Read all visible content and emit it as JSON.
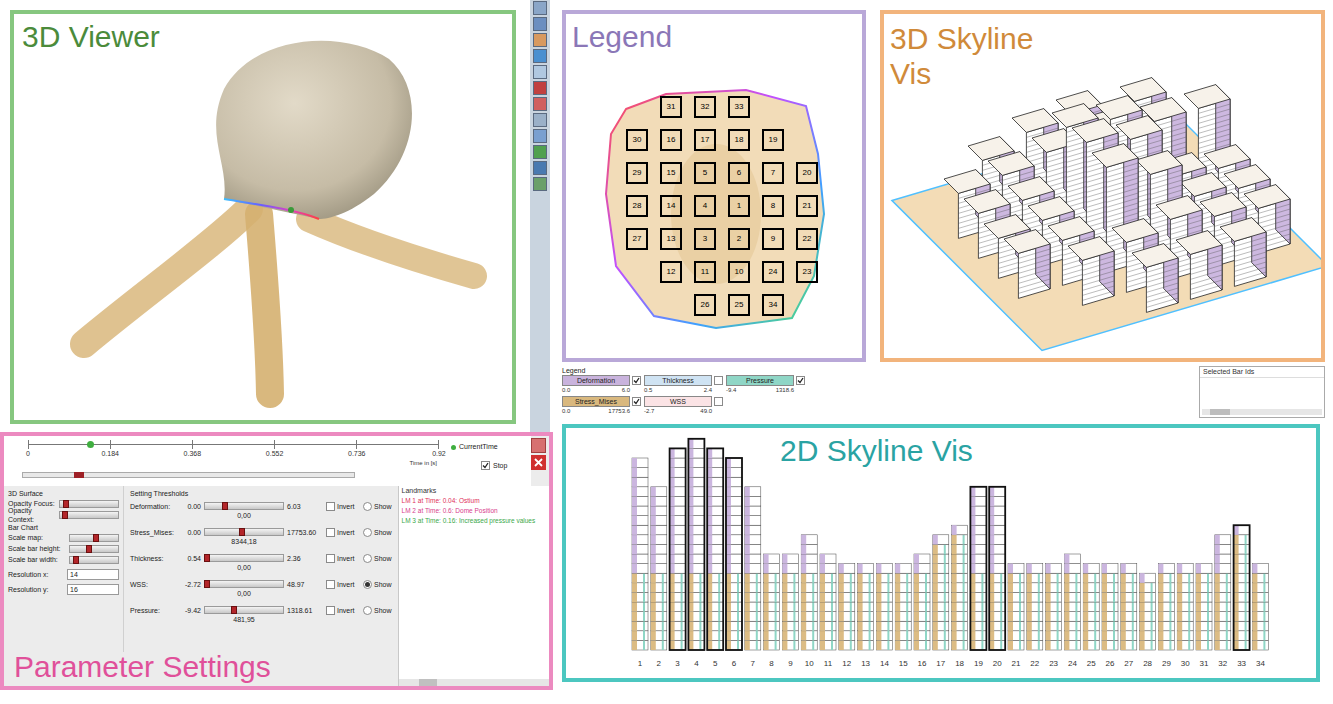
{
  "viewer3d": {
    "title": "3D Viewer"
  },
  "legendPanel": {
    "title": "Legend",
    "grid": [
      [
        null,
        "31",
        "32",
        "33",
        null,
        null
      ],
      [
        "30",
        "16",
        "17",
        "18",
        "19",
        null
      ],
      [
        "29",
        "15",
        "5",
        "6",
        "7",
        "20"
      ],
      [
        "28",
        "14",
        "4",
        "1",
        "8",
        "21"
      ],
      [
        "27",
        "13",
        "3",
        "2",
        "9",
        "22"
      ],
      [
        null,
        "12",
        "11",
        "10",
        "24",
        "23"
      ],
      [
        null,
        null,
        "26",
        "25",
        "34",
        null
      ]
    ]
  },
  "skyline3d": {
    "titleLines": [
      "3D Skyline",
      "Vis"
    ]
  },
  "legendBar": {
    "title": "Legend",
    "items": [
      {
        "label": "Deformation",
        "checked": true,
        "min": "0.0",
        "max": "6.0",
        "color": "#c9b3dd"
      },
      {
        "label": "Thickness",
        "checked": false,
        "min": "0.5",
        "max": "2.4",
        "color": "#cfe3f3"
      },
      {
        "label": "Pressure",
        "checked": true,
        "min": "-9.4",
        "max": "1318.6",
        "color": "#8fd6c6"
      },
      {
        "label": "Stress_Mises",
        "checked": true,
        "min": "0.0",
        "max": "17753.6",
        "color": "#d9b87e"
      },
      {
        "label": "WSS",
        "checked": false,
        "min": "-2.7",
        "max": "49.0",
        "color": "#fbe3e5"
      }
    ]
  },
  "selectedBars": {
    "title": "Selected Bar Ids"
  },
  "skyline2d": {
    "title": "2D Skyline Vis",
    "bars": [
      {
        "label": "1",
        "height": 20,
        "stress": 8,
        "outlined": false
      },
      {
        "label": "2",
        "height": 17,
        "stress": 8,
        "outlined": false
      },
      {
        "label": "3",
        "height": 21,
        "stress": 8,
        "outlined": true
      },
      {
        "label": "4",
        "height": 22,
        "stress": 8,
        "outlined": true
      },
      {
        "label": "5",
        "height": 21,
        "stress": 8,
        "outlined": true
      },
      {
        "label": "6",
        "height": 20,
        "stress": 8,
        "outlined": true
      },
      {
        "label": "7",
        "height": 17,
        "stress": 8,
        "outlined": false
      },
      {
        "label": "8",
        "height": 10,
        "stress": 8,
        "outlined": false
      },
      {
        "label": "9",
        "height": 10,
        "stress": 8,
        "outlined": false
      },
      {
        "label": "10",
        "height": 12,
        "stress": 8,
        "outlined": false
      },
      {
        "label": "11",
        "height": 10,
        "stress": 8,
        "outlined": false
      },
      {
        "label": "12",
        "height": 9,
        "stress": 8,
        "outlined": false
      },
      {
        "label": "13",
        "height": 9,
        "stress": 8,
        "outlined": false
      },
      {
        "label": "14",
        "height": 9,
        "stress": 8,
        "outlined": false
      },
      {
        "label": "15",
        "height": 9,
        "stress": 8,
        "outlined": false
      },
      {
        "label": "16",
        "height": 10,
        "stress": 8,
        "outlined": false
      },
      {
        "label": "17",
        "height": 12,
        "stress": 11,
        "outlined": false
      },
      {
        "label": "18",
        "height": 13,
        "stress": 12,
        "outlined": false
      },
      {
        "label": "19",
        "height": 17,
        "stress": 8,
        "outlined": true
      },
      {
        "label": "20",
        "height": 17,
        "stress": 8,
        "outlined": true
      },
      {
        "label": "21",
        "height": 9,
        "stress": 8,
        "outlined": false
      },
      {
        "label": "22",
        "height": 9,
        "stress": 8,
        "outlined": false
      },
      {
        "label": "23",
        "height": 9,
        "stress": 8,
        "outlined": false
      },
      {
        "label": "24",
        "height": 10,
        "stress": 8,
        "outlined": false
      },
      {
        "label": "25",
        "height": 9,
        "stress": 8,
        "outlined": false
      },
      {
        "label": "26",
        "height": 9,
        "stress": 8,
        "outlined": false
      },
      {
        "label": "27",
        "height": 9,
        "stress": 8,
        "outlined": false
      },
      {
        "label": "28",
        "height": 8,
        "stress": 7,
        "outlined": false
      },
      {
        "label": "29",
        "height": 9,
        "stress": 8,
        "outlined": false
      },
      {
        "label": "30",
        "height": 9,
        "stress": 8,
        "outlined": false
      },
      {
        "label": "31",
        "height": 9,
        "stress": 8,
        "outlined": false
      },
      {
        "label": "32",
        "height": 12,
        "stress": 8,
        "outlined": false
      },
      {
        "label": "33",
        "height": 13,
        "stress": 12,
        "outlined": true
      },
      {
        "label": "34",
        "height": 9,
        "stress": 8,
        "outlined": false
      }
    ]
  },
  "params": {
    "title": "Parameter Settings",
    "timeline": {
      "ticks": [
        "0",
        "0.184",
        "0.368",
        "0.552",
        "0.736",
        "0.92"
      ],
      "axisLabel": "Time in [s]",
      "legend": "CurrentTime",
      "currentTime": 0.15,
      "progress": 0.17,
      "stop": {
        "label": "Stop",
        "checked": true
      }
    },
    "surface": {
      "title": "3D Surface",
      "sliders": [
        {
          "label": "Opacity Focus:",
          "level": 0.1
        },
        {
          "label": "Opacity Context:",
          "level": 0.08
        }
      ]
    },
    "barChart": {
      "title": "Bar Chart",
      "sliders": [
        {
          "label": "Scale map:",
          "level": 0.55
        },
        {
          "label": "Scale bar height:",
          "level": 0.4
        },
        {
          "label": "Scale bar width:",
          "level": 0.12
        }
      ],
      "fields": [
        {
          "label": "Resolution x:",
          "value": "14"
        },
        {
          "label": "Resolution y:",
          "value": "16"
        }
      ]
    },
    "thresholds": {
      "title": "Setting Thresholds",
      "rows": [
        {
          "label": "Deformation:",
          "min": "0.00",
          "max": "6.03",
          "value": "0,00",
          "level": 0.25,
          "invert": {
            "label": "Invert",
            "checked": false
          },
          "show": {
            "label": "Show",
            "selected": false
          }
        },
        {
          "label": "Stress_Mises:",
          "min": "0.00",
          "max": "17753.60",
          "value": "8344,18",
          "level": 0.47,
          "invert": {
            "label": "Invert",
            "checked": false
          },
          "show": {
            "label": "Show",
            "selected": false
          }
        },
        {
          "label": "Thickness:",
          "min": "0.54",
          "max": "2.36",
          "value": "0,00",
          "level": 0.02,
          "invert": {
            "label": "Invert",
            "checked": false
          },
          "show": {
            "label": "Show",
            "selected": false
          }
        },
        {
          "label": "WSS:",
          "min": "-2.72",
          "max": "48.97",
          "value": "0,00",
          "level": 0.02,
          "invert": {
            "label": "Invert",
            "checked": false
          },
          "show": {
            "label": "Show",
            "selected": true
          }
        },
        {
          "label": "Pressure:",
          "min": "-9.42",
          "max": "1318.61",
          "value": "481,95",
          "level": 0.37,
          "invert": {
            "label": "Invert",
            "checked": false
          },
          "show": {
            "label": "Show",
            "selected": false
          }
        }
      ]
    },
    "landmarks": {
      "title": "Landmarks",
      "items": [
        {
          "text": "LM 1 at Time: 0.04: Ostium",
          "color": "#e0305a"
        },
        {
          "text": "LM 2 at Time: 0.6: Dome Position",
          "color": "#d8408c"
        },
        {
          "text": "LM 3 at Time: 0.16: Increased pressure values",
          "color": "#3aa84a"
        }
      ]
    }
  }
}
